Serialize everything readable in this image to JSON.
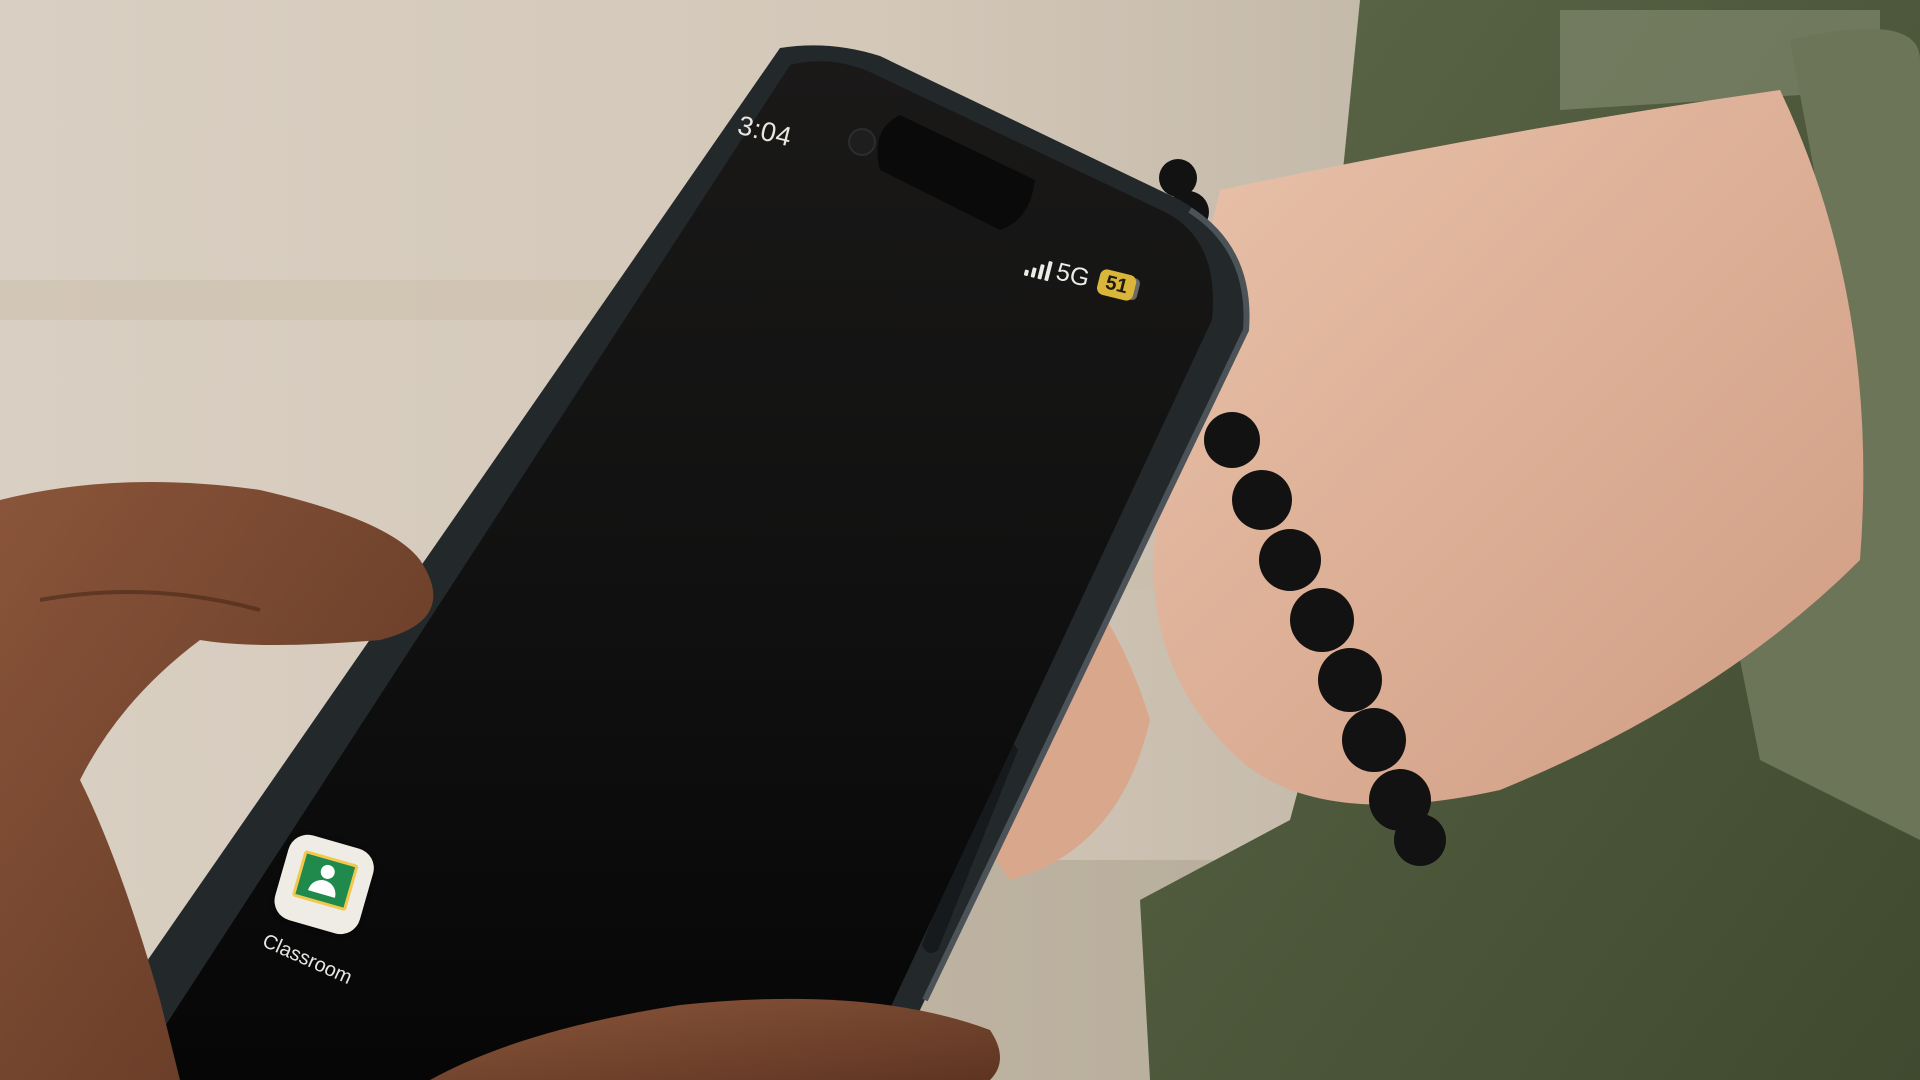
{
  "status_bar": {
    "time": "3:04",
    "network": "5G",
    "battery": "51"
  },
  "home_screen": {
    "apps": [
      {
        "label": "Classroom",
        "icon": "google-classroom-icon"
      }
    ]
  },
  "colors": {
    "background": "#d8cdbf",
    "phone_body": "#1b1e20",
    "screen": "#0e0e0e",
    "battery_badge": "#d9b53a",
    "sweater": "#4f5a3c",
    "classroom_green": "#1f8a4c",
    "classroom_yellow": "#f2c94c"
  }
}
